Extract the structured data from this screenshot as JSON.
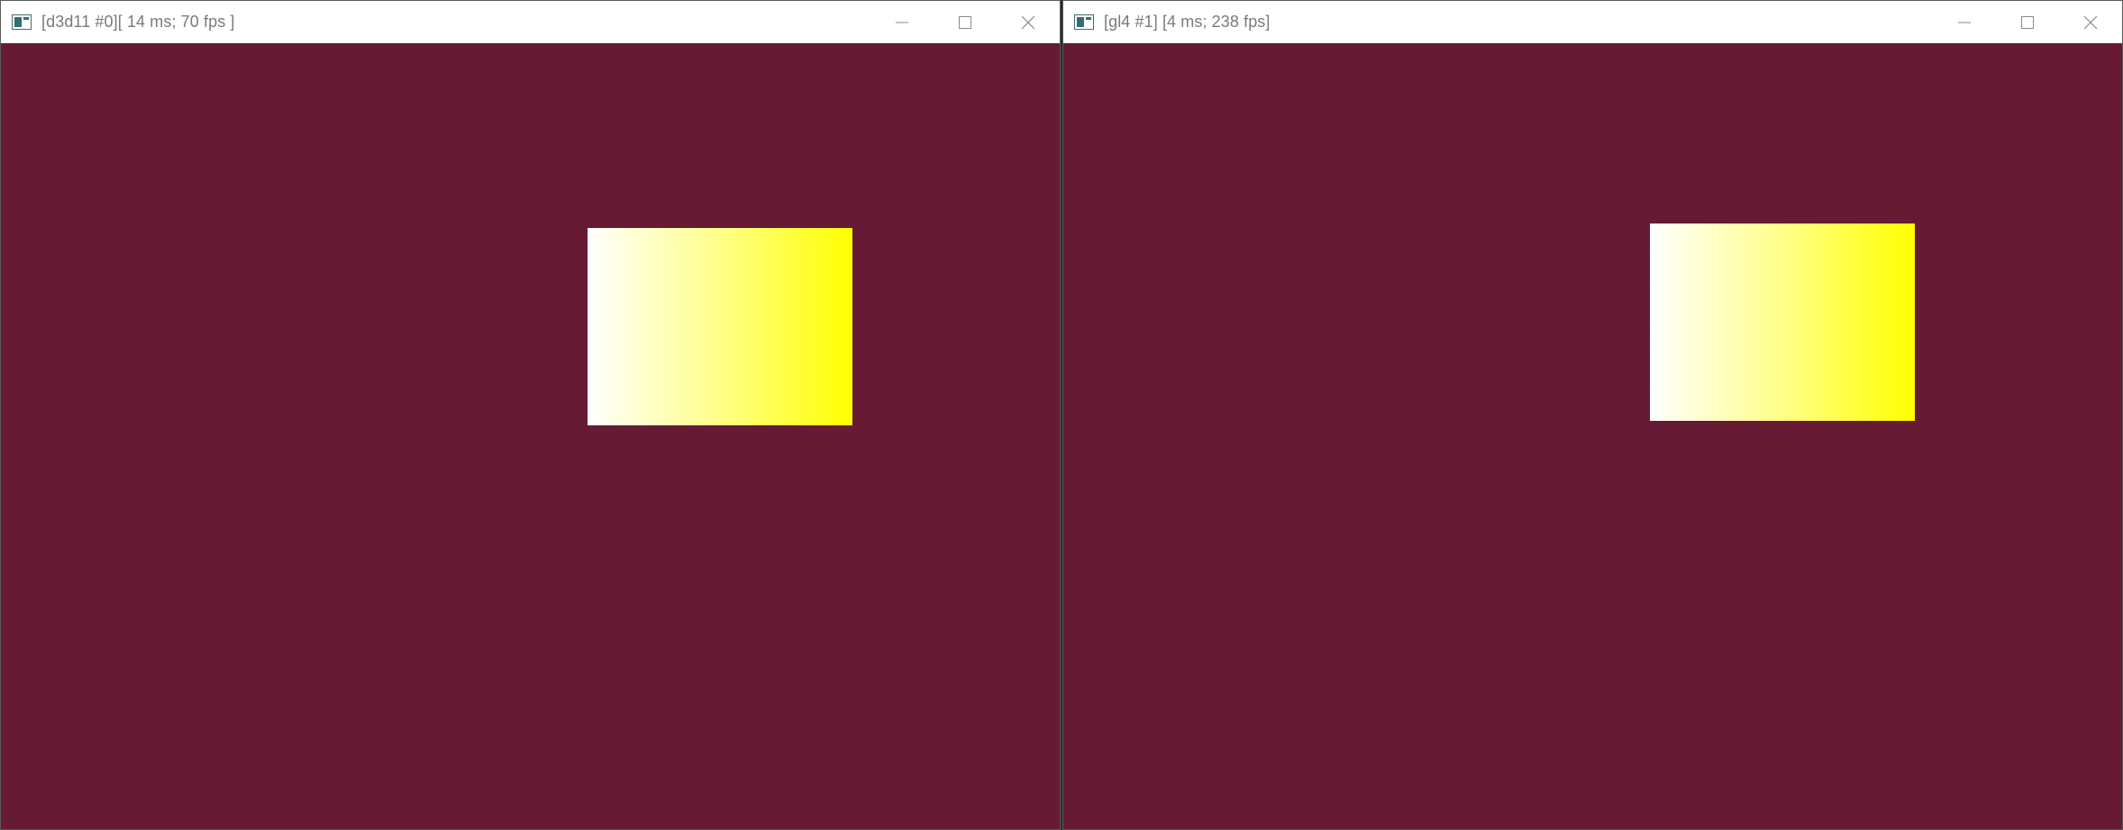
{
  "windows": [
    {
      "title": "[d3d11 #0][ 14 ms; 70 fps ]",
      "icon": "app-window-icon",
      "clear_color": "#661a33",
      "controls": [
        "minimize-icon",
        "maximize-icon",
        "close-icon"
      ]
    },
    {
      "title": "[gl4 #1] [4 ms; 238 fps]",
      "icon": "app-window-icon",
      "clear_color": "#661a33",
      "controls": [
        "minimize-icon",
        "maximize-icon",
        "close-icon"
      ]
    }
  ],
  "quad_gradient": {
    "start": "#ffffff",
    "end": "#ffff00"
  }
}
